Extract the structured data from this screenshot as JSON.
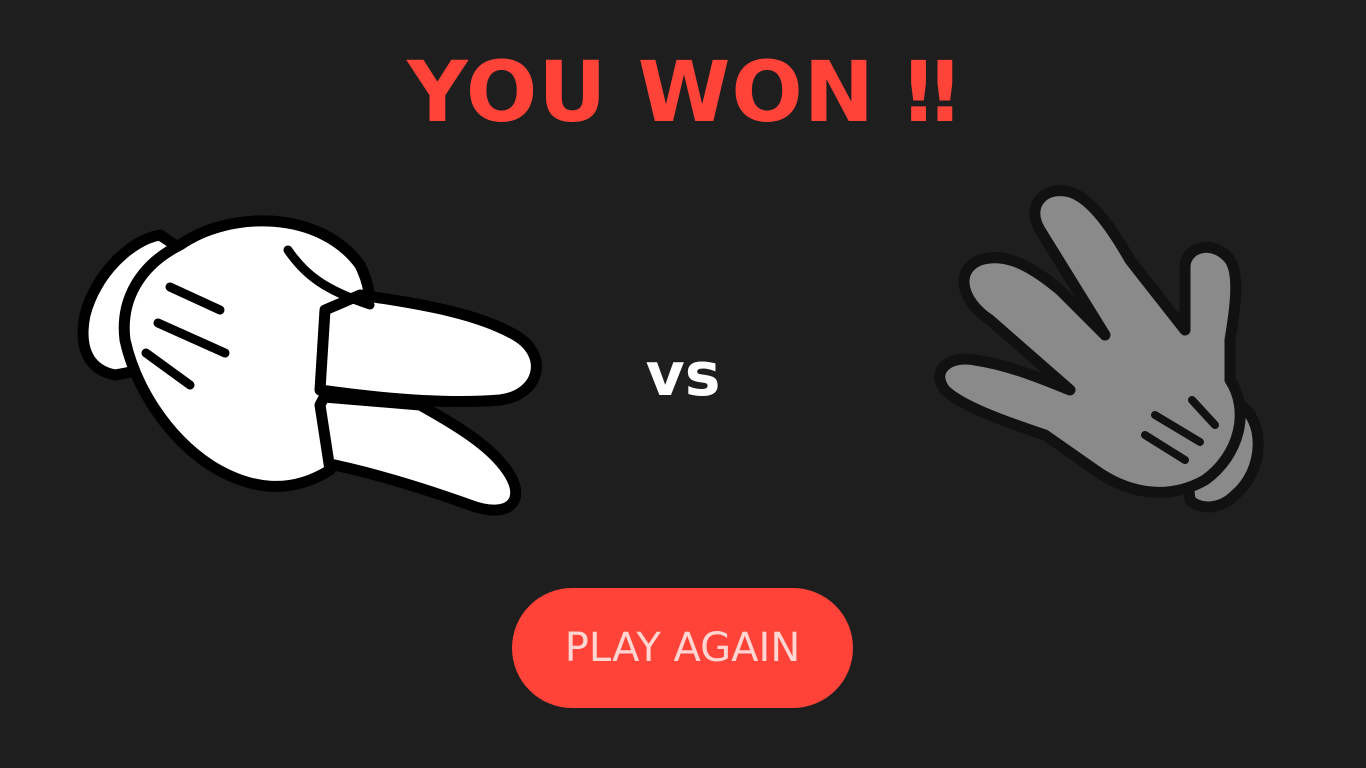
{
  "result": {
    "title": "YOU WON ‼"
  },
  "versus_label": "vs",
  "hands": {
    "player": {
      "gesture": "scissors",
      "icon": "scissors-hand-icon",
      "fill": "#ffffff"
    },
    "computer": {
      "gesture": "paper",
      "icon": "paper-hand-icon",
      "fill": "#8a8a8a"
    }
  },
  "play_again": {
    "label": "PLAY AGAIN"
  },
  "colors": {
    "background": "#1e1e1e",
    "accent": "#ff4338",
    "button_text": "#ffd6d2"
  }
}
